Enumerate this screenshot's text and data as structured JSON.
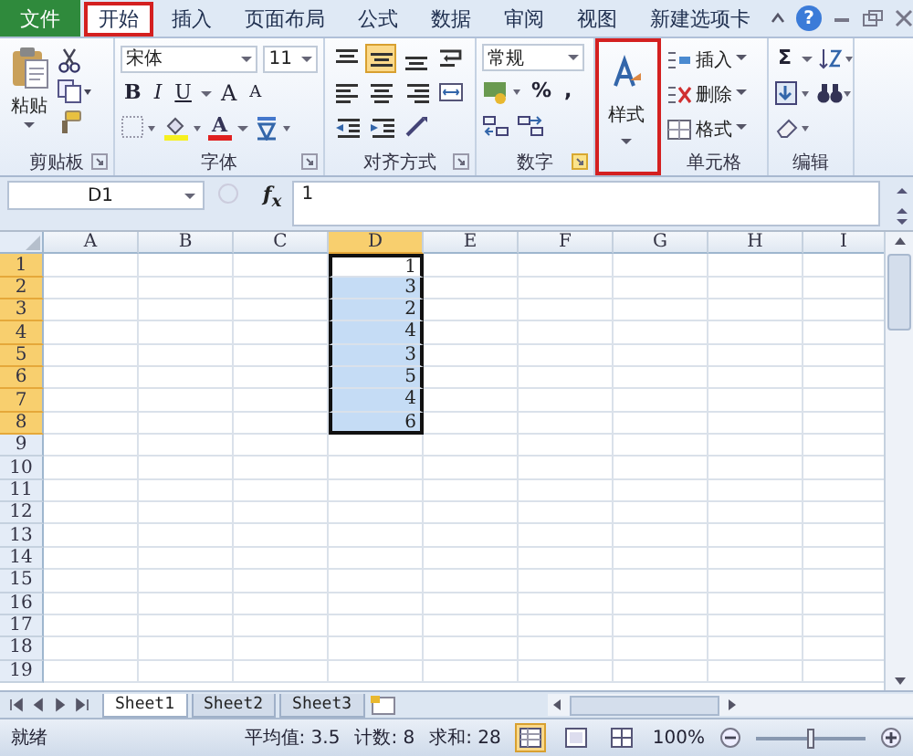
{
  "tabs": [
    {
      "label": "文件",
      "kind": "file",
      "selected": false,
      "highlighted": false
    },
    {
      "label": "开始",
      "kind": "normal",
      "selected": true,
      "highlighted": true
    },
    {
      "label": "插入",
      "kind": "normal",
      "selected": false,
      "highlighted": false
    },
    {
      "label": "页面布局",
      "kind": "normal",
      "selected": false,
      "highlighted": false
    },
    {
      "label": "公式",
      "kind": "normal",
      "selected": false,
      "highlighted": false
    },
    {
      "label": "数据",
      "kind": "normal",
      "selected": false,
      "highlighted": false
    },
    {
      "label": "审阅",
      "kind": "normal",
      "selected": false,
      "highlighted": false
    },
    {
      "label": "视图",
      "kind": "normal",
      "selected": false,
      "highlighted": false
    },
    {
      "label": "新建选项卡",
      "kind": "normal",
      "selected": false,
      "highlighted": false
    }
  ],
  "help": "?",
  "ribbon": {
    "clipboard": {
      "paste": "粘贴",
      "label": "剪贴板"
    },
    "font": {
      "name": "宋体",
      "size": "11",
      "bold": "B",
      "italic": "I",
      "underline": "U",
      "grow": "A",
      "shrink": "A",
      "color_button": "A",
      "label": "字体"
    },
    "alignment": {
      "buttons": [
        {
          "kind": "top",
          "selected": false
        },
        {
          "kind": "middle",
          "selected": true
        },
        {
          "kind": "bottom",
          "selected": false
        },
        {
          "kind": "wrap",
          "selected": false
        },
        {
          "kind": "left",
          "selected": false
        },
        {
          "kind": "center",
          "selected": false
        },
        {
          "kind": "right",
          "selected": false
        },
        {
          "kind": "merge",
          "selected": false
        },
        {
          "kind": "outdent",
          "selected": false
        },
        {
          "kind": "indent",
          "selected": false
        },
        {
          "kind": "orient",
          "selected": false
        }
      ],
      "label": "对齐方式"
    },
    "number": {
      "format": "常规",
      "percent": "%",
      "comma": ",",
      "label": "数字",
      "launcher_highlighted": true
    },
    "styles": {
      "label": "样式",
      "highlighted": true
    },
    "cells": {
      "items": [
        {
          "kind": "insert",
          "label": "插入"
        },
        {
          "kind": "delete",
          "label": "删除"
        },
        {
          "kind": "format",
          "label": "格式"
        }
      ],
      "label": "单元格"
    },
    "editing": {
      "sum": "Σ",
      "label": "编辑"
    }
  },
  "formula_bar": {
    "name_box": "D1",
    "fx": "f$_{x}$",
    "value": "1"
  },
  "sheet": {
    "columns": [
      {
        "label": "A",
        "selected": false
      },
      {
        "label": "B",
        "selected": false
      },
      {
        "label": "C",
        "selected": false
      },
      {
        "label": "D",
        "selected": true,
        "cells": [
          {
            "value": "1",
            "active": true
          },
          {
            "value": "3",
            "active": false
          },
          {
            "value": "2",
            "active": false
          },
          {
            "value": "4",
            "active": false
          },
          {
            "value": "3",
            "active": false
          },
          {
            "value": "5",
            "active": false
          },
          {
            "value": "4",
            "active": false
          },
          {
            "value": "6",
            "active": false
          }
        ]
      },
      {
        "label": "E",
        "selected": false
      },
      {
        "label": "F",
        "selected": false
      },
      {
        "label": "G",
        "selected": false
      },
      {
        "label": "H",
        "selected": false
      },
      {
        "label": "I",
        "selected": false
      }
    ],
    "rows": [
      {
        "label": "1",
        "selected": true
      },
      {
        "label": "2",
        "selected": true
      },
      {
        "label": "3",
        "selected": true
      },
      {
        "label": "4",
        "selected": true
      },
      {
        "label": "5",
        "selected": true
      },
      {
        "label": "6",
        "selected": true
      },
      {
        "label": "7",
        "selected": true
      },
      {
        "label": "8",
        "selected": true
      },
      {
        "label": "9",
        "selected": false
      },
      {
        "label": "10",
        "selected": false
      },
      {
        "label": "11",
        "selected": false
      },
      {
        "label": "12",
        "selected": false
      },
      {
        "label": "13",
        "selected": false
      },
      {
        "label": "14",
        "selected": false
      },
      {
        "label": "15",
        "selected": false
      },
      {
        "label": "16",
        "selected": false
      },
      {
        "label": "17",
        "selected": false
      },
      {
        "label": "18",
        "selected": false
      },
      {
        "label": "19",
        "selected": false
      }
    ]
  },
  "sheet_tabs": [
    {
      "label": "Sheet1",
      "selected": true
    },
    {
      "label": "Sheet2",
      "selected": false
    },
    {
      "label": "Sheet3",
      "selected": false
    }
  ],
  "status_bar": {
    "ready": "就绪",
    "stats": [
      "平均值: 3.5",
      "计数: 8",
      "求和: 28"
    ],
    "views": [
      {
        "kind": "normal",
        "selected": true
      },
      {
        "kind": "layout",
        "selected": false
      },
      {
        "kind": "pagebreak",
        "selected": false
      }
    ],
    "zoom": "100%",
    "zoom_slider": {
      "level": 0.5
    }
  }
}
